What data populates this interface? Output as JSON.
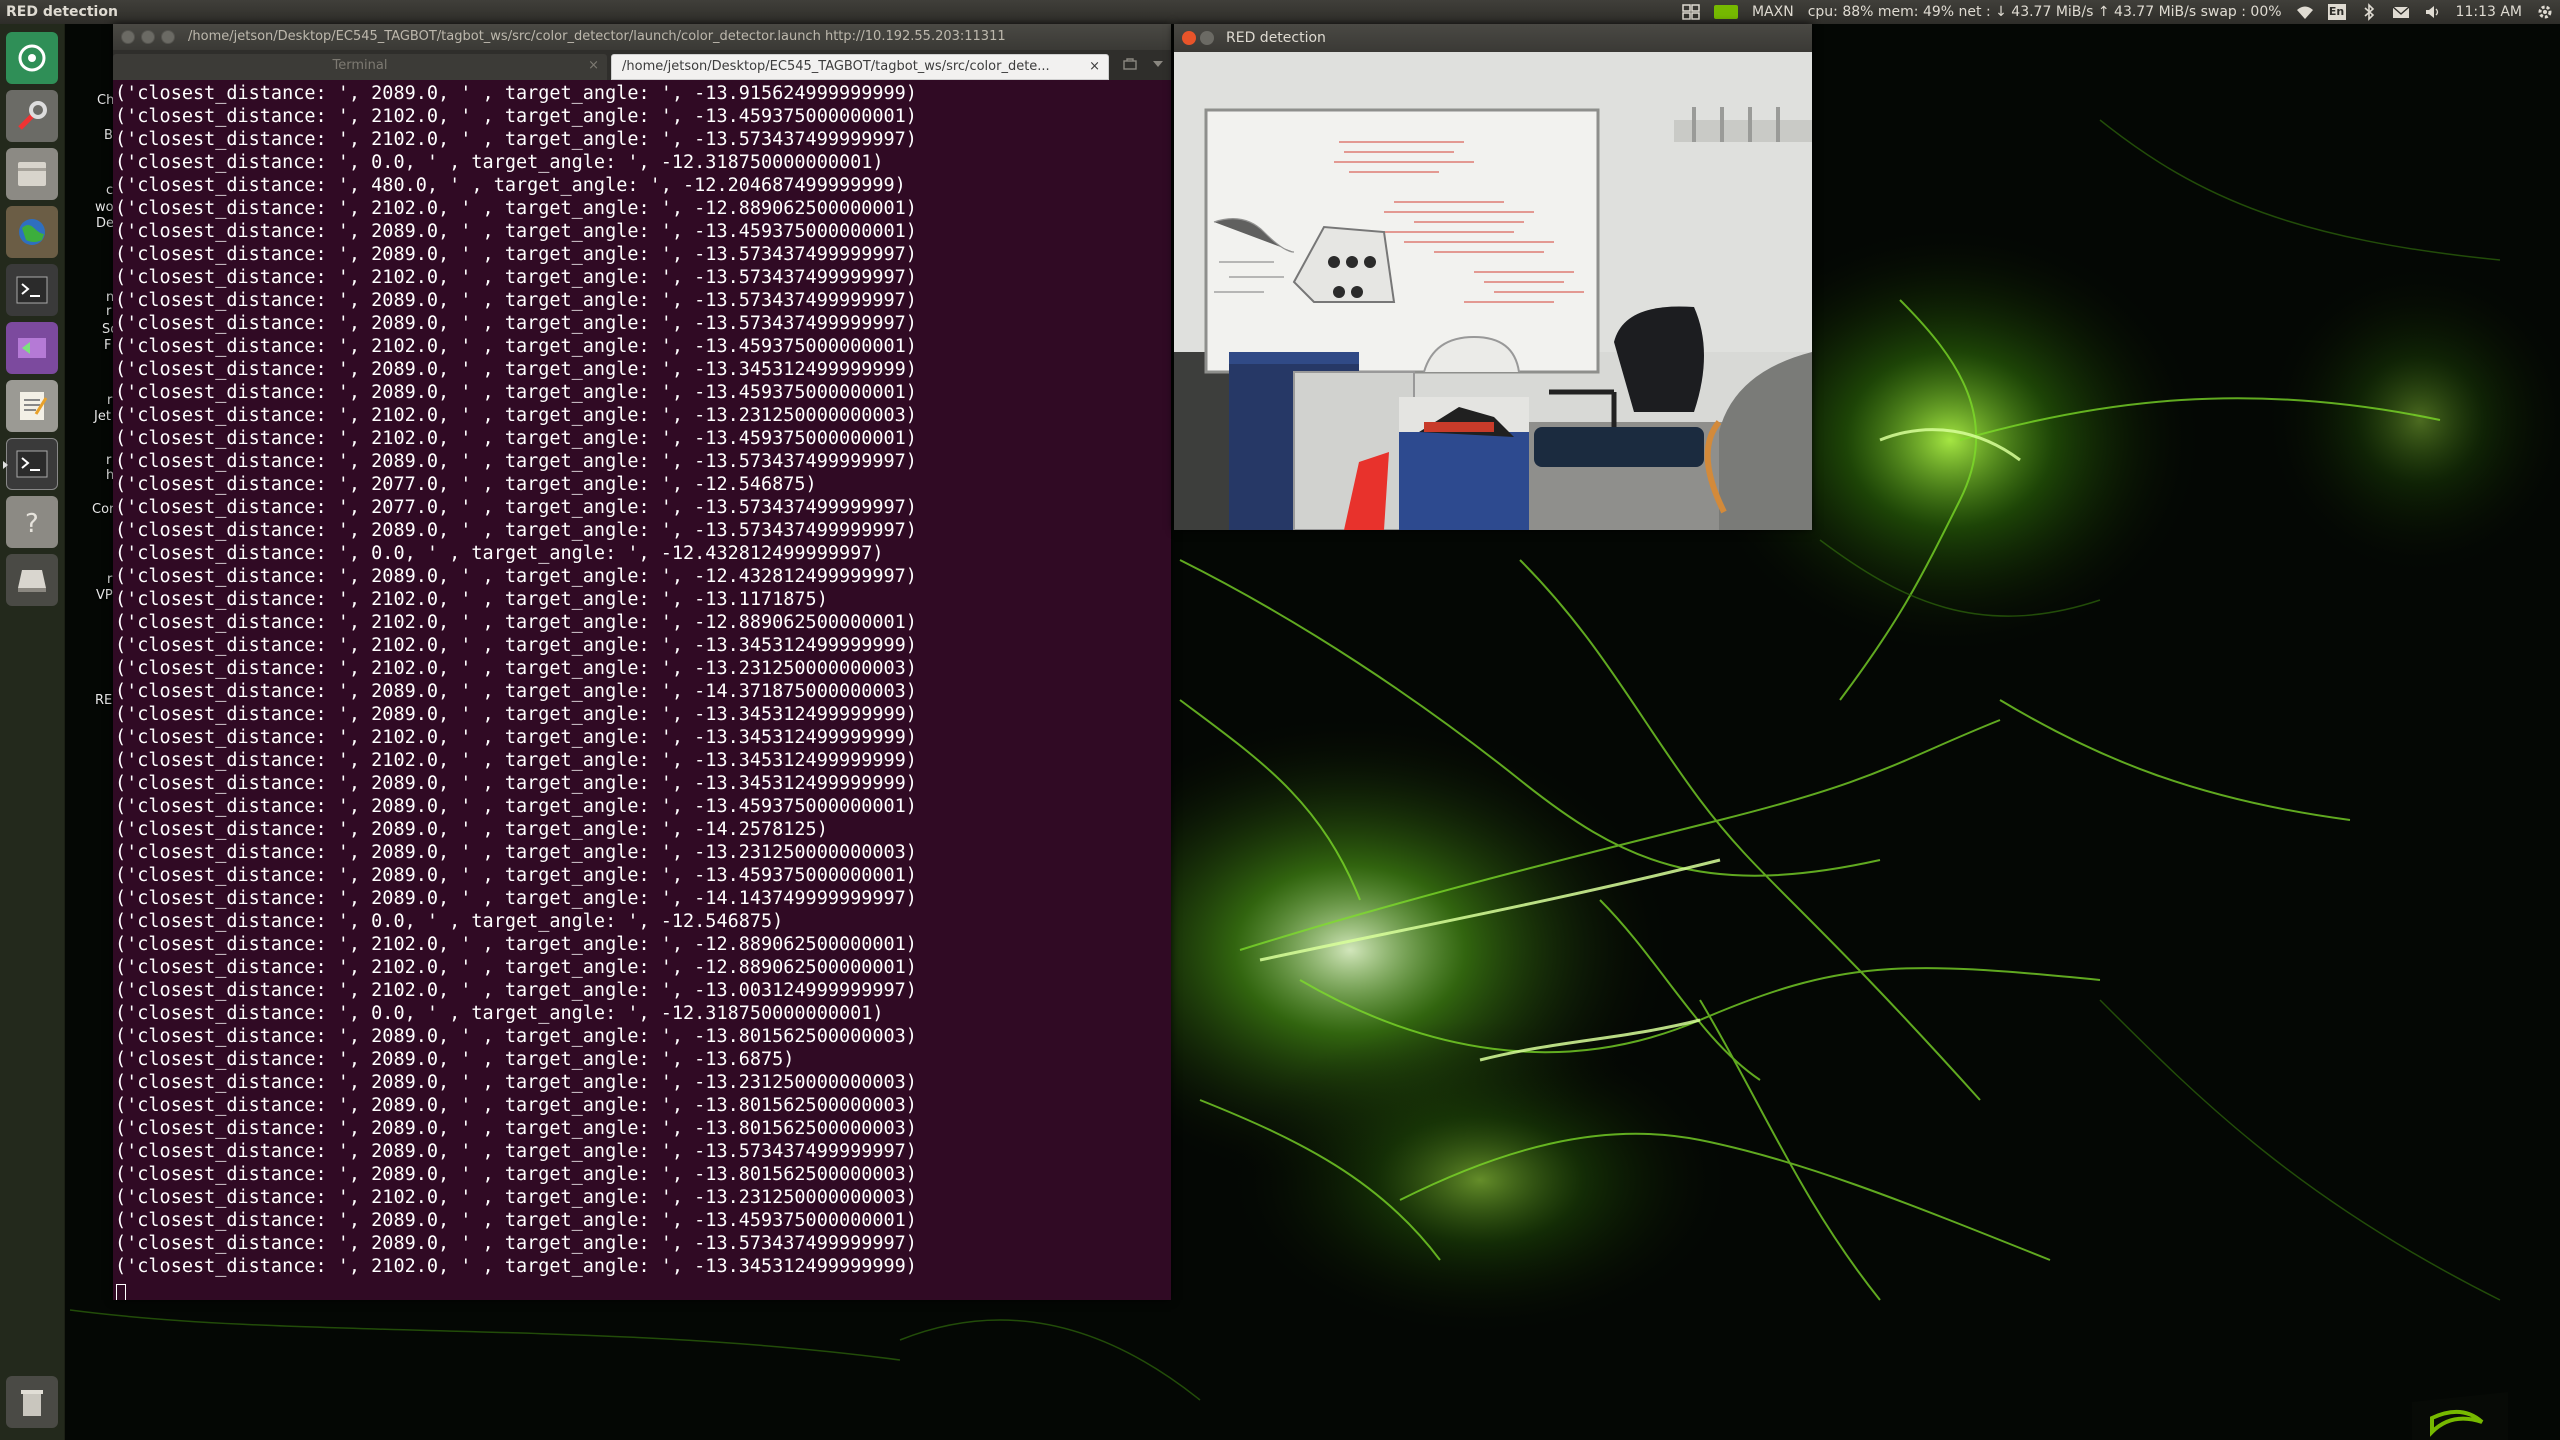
{
  "top_panel": {
    "active_window_title": "RED detection",
    "power_mode": "MAXN",
    "system_monitor": "cpu: 88% mem: 49% net : ↓ 43.77 MiB/s ↑ 43.77 MiB/s swap : 00%",
    "keyboard_layout": "En",
    "clock": "11:13 AM",
    "icons": [
      "workspaces-icon",
      "nvidia-icon",
      "wifi-icon",
      "keyboard-icon",
      "bluetooth-icon",
      "mail-icon",
      "volume-icon",
      "settings-gear-icon"
    ]
  },
  "launcher": {
    "items": [
      {
        "name": "dash-home-icon"
      },
      {
        "name": "system-settings-icon"
      },
      {
        "name": "file-manager-icon"
      },
      {
        "name": "browser-icon"
      },
      {
        "name": "terminal-icon"
      },
      {
        "name": "remote-desktop-icon"
      },
      {
        "name": "text-editor-icon"
      },
      {
        "name": "terminal-icon-2"
      },
      {
        "name": "help-icon"
      },
      {
        "name": "drive-icon"
      },
      {
        "name": "trash-icon"
      }
    ]
  },
  "desktop_labels": [
    "Ch",
    "B",
    "c",
    "wo",
    "De",
    "n",
    "r",
    "Sc",
    "F",
    "r",
    "Jet",
    "r",
    "h",
    "Cor",
    "r",
    "VP",
    "RE"
  ],
  "terminal": {
    "title": "/home/jetson/Desktop/EC545_TAGBOT/tagbot_ws/src/color_detector/launch/color_detector.launch http://10.192.55.203:11311",
    "tabs": [
      {
        "label": "Terminal",
        "close": "×"
      },
      {
        "label": "/home/jetson/Desktop/EC545_TAGBOT/tagbot_ws/src/color_dete...",
        "close": "×"
      }
    ],
    "lines": [
      "('closest_distance: ', 2089.0, ' , target_angle: ', -13.915624999999999)",
      "('closest_distance: ', 2102.0, ' , target_angle: ', -13.459375000000001)",
      "('closest_distance: ', 2102.0, ' , target_angle: ', -13.573437499999997)",
      "('closest_distance: ', 0.0, ' , target_angle: ', -12.318750000000001)",
      "('closest_distance: ', 480.0, ' , target_angle: ', -12.204687499999999)",
      "('closest_distance: ', 2102.0, ' , target_angle: ', -12.889062500000001)",
      "('closest_distance: ', 2089.0, ' , target_angle: ', -13.459375000000001)",
      "('closest_distance: ', 2089.0, ' , target_angle: ', -13.573437499999997)",
      "('closest_distance: ', 2102.0, ' , target_angle: ', -13.573437499999997)",
      "('closest_distance: ', 2089.0, ' , target_angle: ', -13.573437499999997)",
      "('closest_distance: ', 2089.0, ' , target_angle: ', -13.573437499999997)",
      "('closest_distance: ', 2102.0, ' , target_angle: ', -13.459375000000001)",
      "('closest_distance: ', 2089.0, ' , target_angle: ', -13.345312499999999)",
      "('closest_distance: ', 2089.0, ' , target_angle: ', -13.459375000000001)",
      "('closest_distance: ', 2102.0, ' , target_angle: ', -13.231250000000003)",
      "('closest_distance: ', 2102.0, ' , target_angle: ', -13.459375000000001)",
      "('closest_distance: ', 2089.0, ' , target_angle: ', -13.573437499999997)",
      "('closest_distance: ', 2077.0, ' , target_angle: ', -12.546875)",
      "('closest_distance: ', 2077.0, ' , target_angle: ', -13.573437499999997)",
      "('closest_distance: ', 2089.0, ' , target_angle: ', -13.573437499999997)",
      "('closest_distance: ', 0.0, ' , target_angle: ', -12.432812499999997)",
      "('closest_distance: ', 2089.0, ' , target_angle: ', -12.432812499999997)",
      "('closest_distance: ', 2102.0, ' , target_angle: ', -13.1171875)",
      "('closest_distance: ', 2102.0, ' , target_angle: ', -12.889062500000001)",
      "('closest_distance: ', 2102.0, ' , target_angle: ', -13.345312499999999)",
      "('closest_distance: ', 2102.0, ' , target_angle: ', -13.231250000000003)",
      "('closest_distance: ', 2089.0, ' , target_angle: ', -14.371875000000003)",
      "('closest_distance: ', 2089.0, ' , target_angle: ', -13.345312499999999)",
      "('closest_distance: ', 2102.0, ' , target_angle: ', -13.345312499999999)",
      "('closest_distance: ', 2102.0, ' , target_angle: ', -13.345312499999999)",
      "('closest_distance: ', 2089.0, ' , target_angle: ', -13.345312499999999)",
      "('closest_distance: ', 2089.0, ' , target_angle: ', -13.459375000000001)",
      "('closest_distance: ', 2089.0, ' , target_angle: ', -14.2578125)",
      "('closest_distance: ', 2089.0, ' , target_angle: ', -13.231250000000003)",
      "('closest_distance: ', 2089.0, ' , target_angle: ', -13.459375000000001)",
      "('closest_distance: ', 2089.0, ' , target_angle: ', -14.143749999999997)",
      "('closest_distance: ', 0.0, ' , target_angle: ', -12.546875)",
      "('closest_distance: ', 2102.0, ' , target_angle: ', -12.889062500000001)",
      "('closest_distance: ', 2102.0, ' , target_angle: ', -12.889062500000001)",
      "('closest_distance: ', 2102.0, ' , target_angle: ', -13.003124999999997)",
      "('closest_distance: ', 0.0, ' , target_angle: ', -12.318750000000001)",
      "('closest_distance: ', 2089.0, ' , target_angle: ', -13.801562500000003)",
      "('closest_distance: ', 2089.0, ' , target_angle: ', -13.6875)",
      "('closest_distance: ', 2089.0, ' , target_angle: ', -13.231250000000003)",
      "('closest_distance: ', 2089.0, ' , target_angle: ', -13.801562500000003)",
      "('closest_distance: ', 2089.0, ' , target_angle: ', -13.801562500000003)",
      "('closest_distance: ', 2089.0, ' , target_angle: ', -13.573437499999997)",
      "('closest_distance: ', 2089.0, ' , target_angle: ', -13.801562500000003)",
      "('closest_distance: ', 2102.0, ' , target_angle: ', -13.231250000000003)",
      "('closest_distance: ', 2089.0, ' , target_angle: ', -13.459375000000001)",
      "('closest_distance: ', 2089.0, ' , target_angle: ', -13.573437499999997)",
      "('closest_distance: ', 2102.0, ' , target_angle: ', -13.345312499999999)"
    ]
  },
  "red_window": {
    "title": "RED detection"
  },
  "colors": {
    "terminal_bg": "#300a24",
    "panel_bg": "#3a3935",
    "accent_green": "#76b900",
    "close_orange": "#e8542a"
  }
}
